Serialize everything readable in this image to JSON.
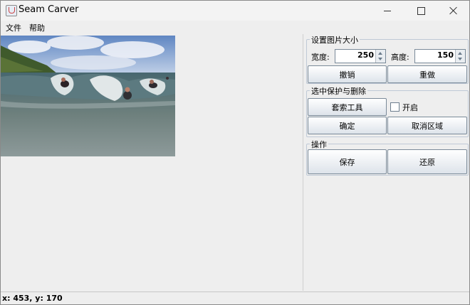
{
  "window": {
    "title": "Seam Carver"
  },
  "menu": {
    "file": "文件",
    "help": "帮助"
  },
  "resize_group": {
    "title": "设置图片大小",
    "width_label": "宽度:",
    "width_value": "250",
    "height_label": "高度:",
    "height_value": "150",
    "undo_label": "撤销",
    "redo_label": "重做"
  },
  "protect_group": {
    "title": "选中保护与删除",
    "lasso_label": "套索工具",
    "enable_label": "开启",
    "enabled": false,
    "confirm_label": "确定",
    "cancel_region_label": "取消区域"
  },
  "ops_group": {
    "title": "操作",
    "save_label": "保存",
    "restore_label": "还原"
  },
  "status": {
    "coords": "x: 453, y: 170"
  },
  "icons": {
    "app": "java-cup-icon",
    "minimize": "minimize-icon",
    "maximize": "maximize-icon",
    "close": "close-icon"
  }
}
